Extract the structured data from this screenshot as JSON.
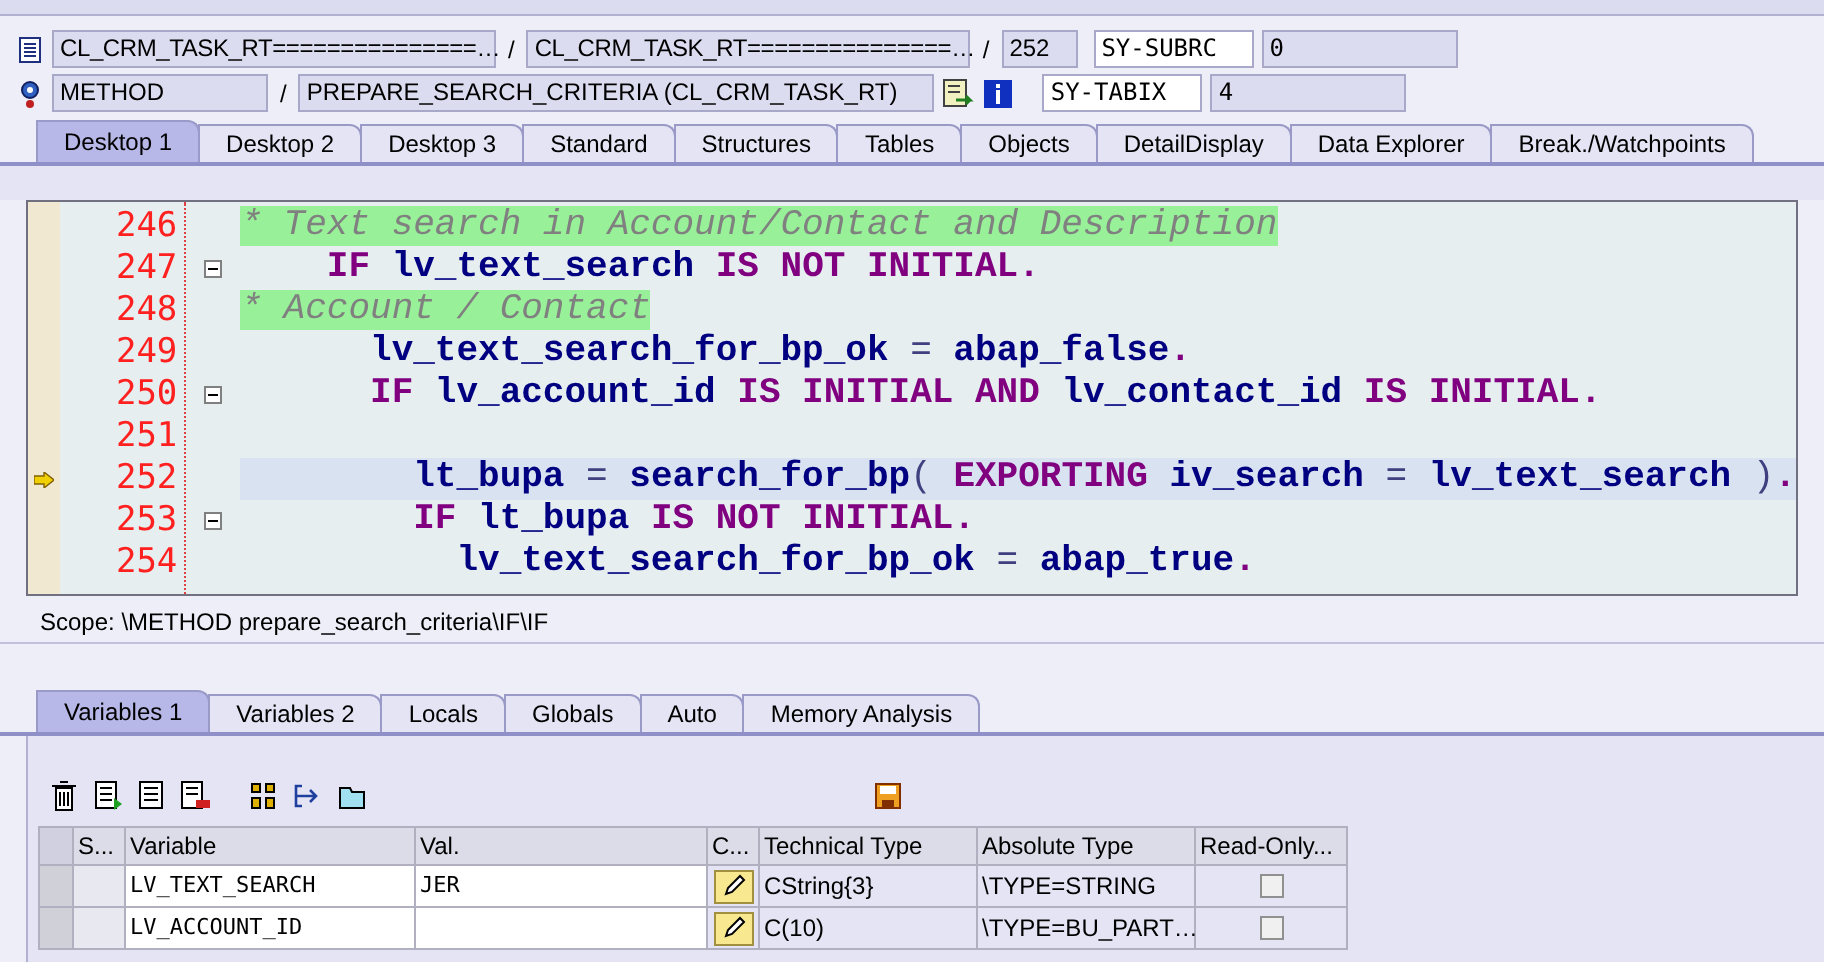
{
  "header": {
    "row1": {
      "include": "CL_CRM_TASK_RT===============…",
      "sep1": "/",
      "program": "CL_CRM_TASK_RT===============…",
      "sep2": "/",
      "line": "252",
      "sys_name": "SY-SUBRC",
      "sys_value": "0"
    },
    "row2": {
      "event_type": "METHOD",
      "sep": "/",
      "event": "PREPARE_SEARCH_CRITERIA (CL_CRM_TASK_RT)",
      "sys_name": "SY-TABIX",
      "sys_value": "4"
    }
  },
  "desktop_tabs": [
    {
      "label": "Desktop 1",
      "selected": true
    },
    {
      "label": "Desktop 2",
      "selected": false
    },
    {
      "label": "Desktop 3",
      "selected": false
    },
    {
      "label": "Standard",
      "selected": false
    },
    {
      "label": "Structures",
      "selected": false
    },
    {
      "label": "Tables",
      "selected": false
    },
    {
      "label": "Objects",
      "selected": false
    },
    {
      "label": "DetailDisplay",
      "selected": false
    },
    {
      "label": "Data Explorer",
      "selected": false
    },
    {
      "label": "Break./Watchpoints",
      "selected": false
    }
  ],
  "code": [
    {
      "number": "246",
      "fold": false,
      "current": false,
      "segments": [
        {
          "kind": "comment",
          "text": "* Text search in Account/Contact and Description"
        }
      ]
    },
    {
      "number": "247",
      "fold": true,
      "current": false,
      "segments": [
        {
          "kind": "kw",
          "text": "    IF "
        },
        {
          "kind": "id",
          "text": "lv_text_search "
        },
        {
          "kind": "kw",
          "text": "IS NOT INITIAL"
        },
        {
          "kind": "dot",
          "text": "."
        }
      ]
    },
    {
      "number": "248",
      "fold": false,
      "current": false,
      "segments": [
        {
          "kind": "comment",
          "text": "* Account / Contact"
        }
      ]
    },
    {
      "number": "249",
      "fold": false,
      "current": false,
      "segments": [
        {
          "kind": "id",
          "text": "      lv_text_search_for_bp_ok "
        },
        {
          "kind": "sym",
          "text": "= "
        },
        {
          "kind": "id",
          "text": "abap_false"
        },
        {
          "kind": "dot",
          "text": "."
        }
      ]
    },
    {
      "number": "250",
      "fold": true,
      "current": false,
      "segments": [
        {
          "kind": "kw",
          "text": "      IF "
        },
        {
          "kind": "id",
          "text": "lv_account_id "
        },
        {
          "kind": "kw",
          "text": "IS INITIAL AND "
        },
        {
          "kind": "id",
          "text": "lv_contact_id "
        },
        {
          "kind": "kw",
          "text": "IS INITIAL"
        },
        {
          "kind": "dot",
          "text": "."
        }
      ]
    },
    {
      "number": "251",
      "fold": false,
      "current": false
    },
    {
      "number": "252",
      "fold": false,
      "current": true,
      "segments": [
        {
          "kind": "id",
          "text": "        lt_bupa "
        },
        {
          "kind": "sym",
          "text": "= "
        },
        {
          "kind": "id",
          "text": "search_for_bp"
        },
        {
          "kind": "sym",
          "text": "( "
        },
        {
          "kind": "kw",
          "text": "EXPORTING "
        },
        {
          "kind": "id",
          "text": "iv_search "
        },
        {
          "kind": "sym",
          "text": "= "
        },
        {
          "kind": "id",
          "text": "lv_text_search "
        },
        {
          "kind": "sym",
          "text": ")"
        },
        {
          "kind": "dot",
          "text": "."
        }
      ]
    },
    {
      "number": "253",
      "fold": true,
      "current": false,
      "segments": [
        {
          "kind": "kw",
          "text": "        IF "
        },
        {
          "kind": "id",
          "text": "lt_bupa "
        },
        {
          "kind": "kw",
          "text": "IS NOT INITIAL"
        },
        {
          "kind": "dot",
          "text": "."
        }
      ]
    },
    {
      "number": "254",
      "fold": false,
      "current": false,
      "segments": [
        {
          "kind": "id",
          "text": "          lv_text_search_for_bp_ok "
        },
        {
          "kind": "sym",
          "text": "= "
        },
        {
          "kind": "id",
          "text": "abap_true"
        },
        {
          "kind": "dot",
          "text": "."
        }
      ]
    }
  ],
  "scope": "Scope: \\METHOD prepare_search_criteria\\IF\\IF",
  "variable_tabs": [
    {
      "label": "Variables 1",
      "selected": true
    },
    {
      "label": "Variables 2",
      "selected": false
    },
    {
      "label": "Locals",
      "selected": false
    },
    {
      "label": "Globals",
      "selected": false
    },
    {
      "label": "Auto",
      "selected": false
    },
    {
      "label": "Memory Analysis",
      "selected": false
    }
  ],
  "table": {
    "columns": [
      "S...",
      "Variable",
      "Val.",
      "C...",
      "Technical Type",
      "Absolute Type",
      "Read-Only..."
    ],
    "rows": [
      {
        "variable": "LV_TEXT_SEARCH",
        "value": "JER",
        "technical_type": "CString{3}",
        "absolute_type": "\\TYPE=STRING",
        "read_only": false
      },
      {
        "variable": "LV_ACCOUNT_ID",
        "technical_type": "C(10)",
        "absolute_type": "\\TYPE=BU_PART…",
        "read_only": false
      }
    ]
  }
}
